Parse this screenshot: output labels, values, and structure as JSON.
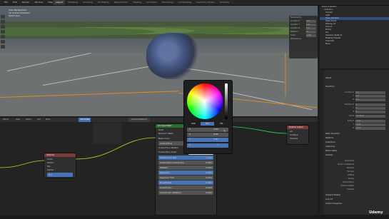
{
  "topbar": {
    "menus": [
      "File",
      "Edit",
      "Render",
      "Window",
      "Help"
    ],
    "tabs": [
      "Layout",
      "Modeling",
      "Sculpting",
      "UV Editing",
      "Texture Paint",
      "Shading",
      "Animation",
      "Rendering",
      "Compositing",
      "Geometry Nodes",
      "Scripting"
    ],
    "active_tab": "Layout"
  },
  "viewport": {
    "overlay_lines": [
      "User Perspective",
      "(1) Scene Collection",
      "Spark lens"
    ]
  },
  "n_panel": {
    "rows": [
      {
        "label": "Show Gizmo",
        "value": ""
      },
      {
        "label": "Location X",
        "value": "0 m"
      },
      {
        "label": "Location Y",
        "value": "0 m"
      },
      {
        "label": "Location Z",
        "value": "0 m"
      },
      {
        "label": "Rotation",
        "value": "0°"
      },
      {
        "label": "Scale",
        "value": "1.000"
      },
      {
        "label": "Dimensions",
        "value": ""
      }
    ]
  },
  "outliner": {
    "items": [
      "Scene Collection",
      "Collection",
      "Camera",
      "Light",
      "Trees_Gaussian",
      "Splat_Points",
      "Parking_Lot",
      "Ground",
      "Empty",
      "Sun",
      "Gaussian_Splat_01",
      "Material_Preview",
      "Cube.001",
      "Plane"
    ],
    "selected_index": 4
  },
  "properties": {
    "sections": [
      "Object",
      "Transform",
      "Delta Transform",
      "Relations",
      "Collections",
      "Instancing",
      "Motion Paths",
      "Visibility",
      "Viewport Display",
      "Line Art",
      "Custom Properties"
    ],
    "transform_rows": [
      {
        "label": "Location X",
        "value": "0 m"
      },
      {
        "label": "Y",
        "value": "0 m"
      },
      {
        "label": "Z",
        "value": "0 m"
      },
      {
        "label": "Rotation X",
        "value": "0°"
      },
      {
        "label": "Y",
        "value": "0°"
      },
      {
        "label": "Z",
        "value": "0°"
      },
      {
        "label": "Mode",
        "value": "XYZ Euler"
      },
      {
        "label": "Scale X",
        "value": "1.000"
      },
      {
        "label": "Y",
        "value": "1.000"
      },
      {
        "label": "Z",
        "value": "1.000"
      }
    ],
    "visibility": [
      "Selectable",
      "Show in Viewports",
      "Renders",
      "Camera",
      "Diffuse",
      "Glossy",
      "Transmission",
      "Volume Scatter",
      "Shadow"
    ]
  },
  "node_editor": {
    "header": [
      "Object",
      "View",
      "Select",
      "Add",
      "Node",
      "Use Nodes"
    ],
    "material": "GaussianMaterial",
    "attribute_node": {
      "title": "Attribute",
      "rows": [
        "Color",
        "Vector",
        "Fac",
        "Alpha"
      ],
      "type_label": "Geometry",
      "name_label": "Name",
      "name_value": "Col"
    },
    "bsdf_node": {
      "title": "Principled BSDF",
      "rows": [
        {
          "label": "GGX",
          "value": ""
        },
        {
          "label": "Random Walk",
          "value": ""
        },
        {
          "label": "Base Color",
          "value": ""
        },
        {
          "label": "Subsurface",
          "value": "0.000"
        },
        {
          "label": "Subsurface Radius",
          "value": ""
        },
        {
          "label": "Subsurface Color",
          "value": ""
        },
        {
          "label": "Subsurface IOR",
          "value": "1.400"
        },
        {
          "label": "Subsurface Anisotropy",
          "value": "0.000"
        },
        {
          "label": "Metallic",
          "value": "0.000"
        },
        {
          "label": "Specular",
          "value": "0.500"
        },
        {
          "label": "Specular Tint",
          "value": "0.000"
        },
        {
          "label": "Roughness",
          "value": "0.500"
        },
        {
          "label": "Anisotropic",
          "value": "0.000"
        },
        {
          "label": "Anisotropic Rotation",
          "value": "0.000"
        }
      ]
    },
    "output_node": {
      "title": "Material Output",
      "rows": [
        "All",
        "Surface",
        "Volume",
        "Displacement"
      ]
    }
  },
  "color_picker": {
    "tabs": [
      "RGB",
      "HSV",
      "HSL"
    ],
    "active_tab": "HSV",
    "rows": [
      {
        "label": "H",
        "value": "0.000"
      },
      {
        "label": "S",
        "value": "0.000"
      },
      {
        "label": "V",
        "value": "0.151"
      },
      {
        "label": "A",
        "value": "1"
      }
    ],
    "value_level": 0.151
  },
  "colors": {
    "accent": "#4772b3",
    "bsdf_header": "#2d6b2f",
    "attribute_header": "#7a3b3b",
    "selection": "#e08a1e"
  },
  "watermark": "Udemy"
}
